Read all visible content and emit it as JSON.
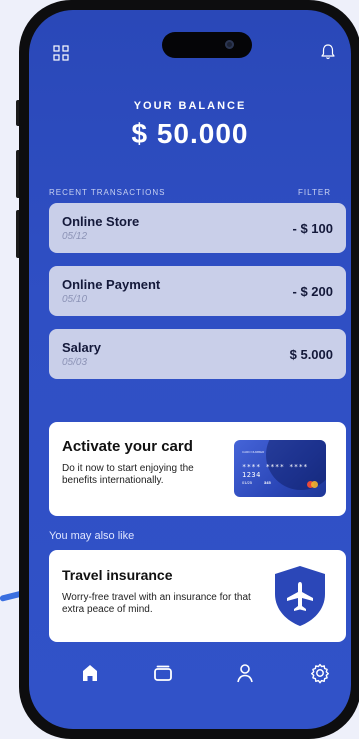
{
  "balance": {
    "label": "YOUR BALANCE",
    "value": "$ 50.000"
  },
  "transactions": {
    "header": "RECENT TRANSACTIONS",
    "filter": "FILTER",
    "items": [
      {
        "name": "Online Store",
        "date": "05/12",
        "amount": "- $ 100"
      },
      {
        "name": "Online Payment",
        "date": "05/10",
        "amount": "- $ 200"
      },
      {
        "name": "Salary",
        "date": "05/03",
        "amount": "$ 5.000"
      }
    ]
  },
  "card_promo": {
    "title": "Activate your card",
    "description": "Do it now to start enjoying the benefits internationally.",
    "card_number": "**** **** **** 1234",
    "card_holder": "CARD NUMBER",
    "card_expiry": "01/25",
    "card_cvv": "345"
  },
  "suggestions": {
    "label": "You may also like",
    "travel": {
      "title": "Travel insurance",
      "description": "Worry-free travel with an insurance for that extra peace of mind."
    }
  },
  "icons": {
    "top_left": "grid-icon",
    "top_right": "bell-icon",
    "tabs": [
      "home-icon",
      "cards-icon",
      "profile-icon",
      "settings-icon"
    ],
    "promo": "airplane-shield-icon"
  },
  "colors": {
    "background": "#2f4fc4",
    "transaction_card": "#c9cfe9",
    "accent": "#2b47b8",
    "text_dark": "#14193a"
  }
}
